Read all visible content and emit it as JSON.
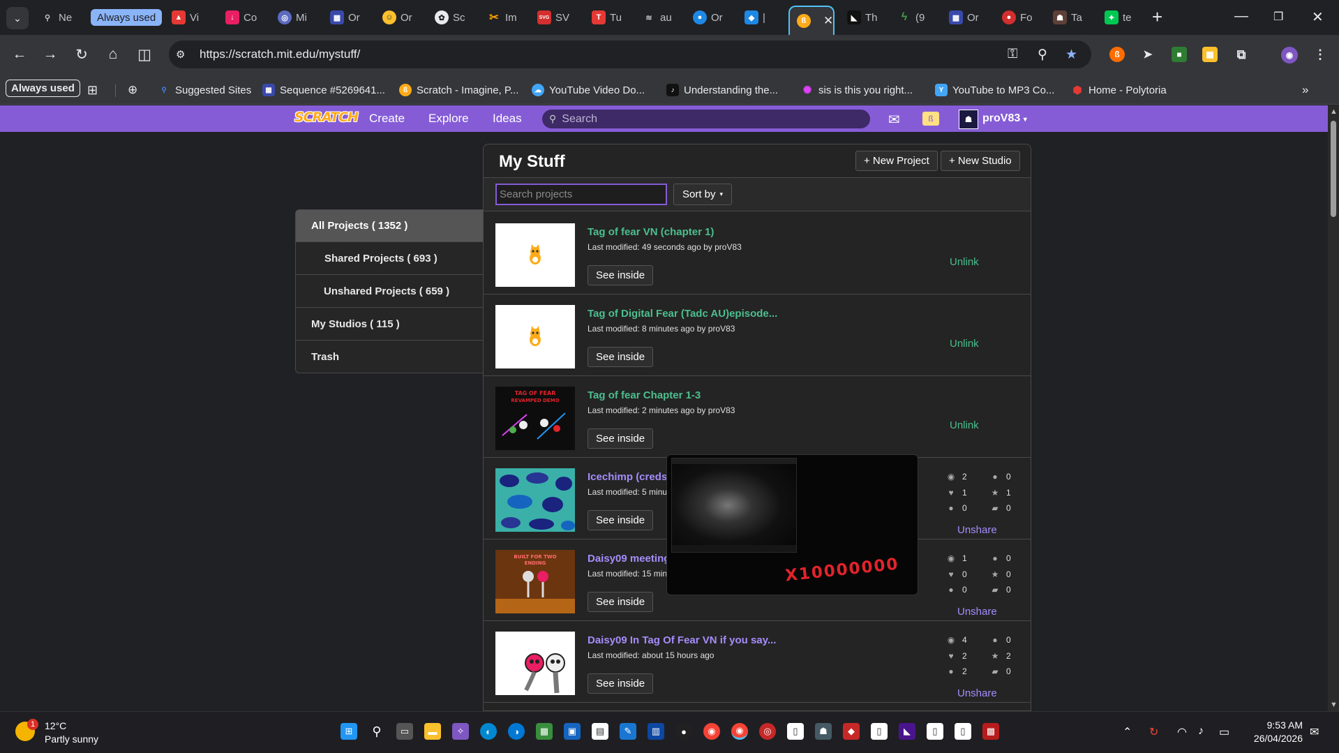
{
  "browser": {
    "tabs": [
      {
        "label": "Ne",
        "icon": "search-icon",
        "color": "#202124"
      },
      {
        "label": "Vi",
        "icon": "vidyard-icon",
        "color": "#e53935"
      },
      {
        "label": "Co",
        "icon": "download-icon",
        "color": "#e91e63"
      },
      {
        "label": "Mi",
        "icon": "app-icon",
        "color": "#5c6bc0"
      },
      {
        "label": "Or",
        "icon": "grid-icon",
        "color": "#3949ab"
      },
      {
        "label": "Or",
        "icon": "smiley-icon",
        "color": "#fbc02d"
      },
      {
        "label": "Sc",
        "icon": "openai-icon",
        "color": "#9e9e9e"
      },
      {
        "label": "Im",
        "icon": "tools-icon",
        "color": "#ffa000"
      },
      {
        "label": "SV",
        "icon": "svgpng-icon",
        "color": "#d32f2f"
      },
      {
        "label": "Tu",
        "icon": "tumblr-icon",
        "color": "#e53935"
      },
      {
        "label": "au",
        "icon": "equalizer-icon",
        "color": "#757575"
      },
      {
        "label": "Or",
        "icon": "shapes-icon",
        "color": "#1e88e5"
      },
      {
        "label": "|",
        "icon": "app-icon",
        "color": "#1e88e5"
      },
      {
        "label": "Th",
        "icon": "face-icon",
        "color": "#111111"
      },
      {
        "label": "(9",
        "icon": "bolt-icon",
        "color": "#43a047"
      },
      {
        "label": "Or",
        "icon": "grid-icon",
        "color": "#3949ab"
      },
      {
        "label": "Fo",
        "icon": "circle-icon",
        "color": "#d32f2f"
      },
      {
        "label": "Ta",
        "icon": "avatar-icon",
        "color": "#5d4037"
      },
      {
        "label": "te",
        "icon": "spark-icon",
        "color": "#00c853"
      }
    ],
    "group_chip": "Always used",
    "active_tab_close": "✕",
    "new_tab": "+",
    "url": "https://scratch.mit.edu/mystuff/",
    "bookmark_chip": "Always used",
    "bookmarks": [
      {
        "label": "Suggested Sites",
        "icon": "search-icon",
        "color": "#4285f4"
      },
      {
        "label": "Sequence #5269641...",
        "icon": "sequence-icon",
        "color": "#3949ab"
      },
      {
        "label": "Scratch - Imagine, P...",
        "icon": "scratch-cat-icon",
        "color": "#ffab19"
      },
      {
        "label": "YouTube Video Do...",
        "icon": "cloud-download-icon",
        "color": "#42a5f5"
      },
      {
        "label": "Understanding the...",
        "icon": "tiktok-icon",
        "color": "#111111"
      },
      {
        "label": "sis is this you right...",
        "icon": "gear-icon",
        "color": "#e040fb"
      },
      {
        "label": "YouTube to MP3 Co...",
        "icon": "y-icon",
        "color": "#42a5f5"
      },
      {
        "label": "Home - Polytoria",
        "icon": "hexagon-icon",
        "color": "#e53935"
      }
    ]
  },
  "scratch_nav": {
    "logo": "SCRATCH",
    "links": [
      "Create",
      "Explore",
      "Ideas"
    ],
    "search_placeholder": "Search",
    "username": "proV83"
  },
  "sidebar": {
    "tabs": [
      "All Projects ( 1352 )",
      "Shared Projects ( 693 )",
      "Unshared Projects ( 659 )",
      "My Studios ( 115 )",
      "Trash"
    ]
  },
  "main": {
    "title": "My Stuff",
    "new_project": "+ New Project",
    "new_studio": "+ New Studio",
    "search_placeholder": "Search projects",
    "sort_label": "Sort by",
    "see_inside": "See inside",
    "projects": [
      {
        "title": "Tag of fear VN (chapter 1)",
        "meta": "Last modified: 49 seconds ago by proV83",
        "action": "Unlink",
        "shared": false
      },
      {
        "title": "Tag of Digital Fear (Tadc AU)episode...",
        "meta": "Last modified: 8 minutes ago by proV83",
        "action": "Unlink",
        "shared": false
      },
      {
        "title": "Tag of fear Chapter 1-3",
        "meta": "Last modified: 2 minutes ago by proV83",
        "action": "Unlink",
        "shared": false
      },
      {
        "title": "Icechimp (creds",
        "meta": "Last modified: 5 minu",
        "action": "Unshare",
        "shared": true,
        "stats": {
          "views": "2",
          "loves": "1",
          "comments": "0",
          "remixes": "0",
          "favorites": "1",
          "studios": "0"
        }
      },
      {
        "title": "Daisy09 meeting",
        "meta": "Last modified: 15 min",
        "action": "Unshare",
        "shared": true,
        "stats": {
          "views": "1",
          "loves": "0",
          "comments": "0",
          "remixes": "0",
          "favorites": "0",
          "studios": "0"
        }
      },
      {
        "title": "Daisy09 In Tag Of Fear VN if you say...",
        "meta": "Last modified: about 15 hours ago",
        "action": "Unshare",
        "shared": true,
        "stats": {
          "views": "4",
          "loves": "2",
          "comments": "2",
          "remixes": "0",
          "favorites": "2",
          "studios": "0"
        }
      }
    ],
    "thumb1_label": "TAG OF FEAR\nREVAMPED DEMO",
    "thumb2_label": "BUILT FOR TWO\nENDING"
  },
  "hover_preview": {
    "text": "X10000000"
  },
  "taskbar": {
    "temp": "12°C",
    "condition": "Partly sunny",
    "weather_badge": "1",
    "time": "9:53 AM",
    "date": "26/04/2026"
  }
}
